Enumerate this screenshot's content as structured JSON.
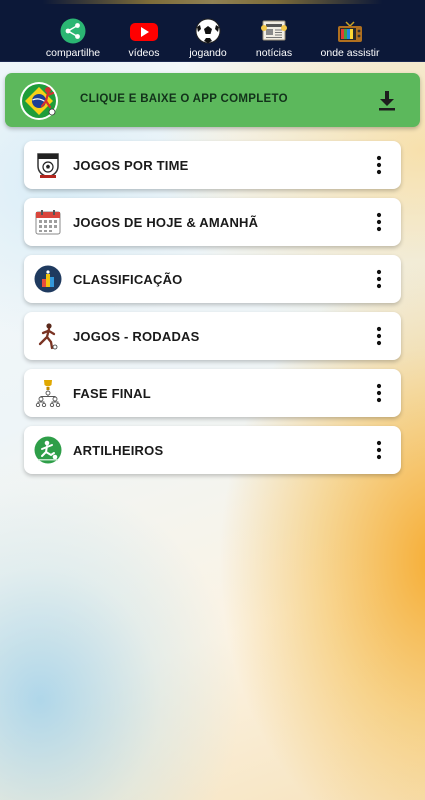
{
  "top_nav": {
    "items": [
      {
        "label": "compartilhe",
        "icon": "share-icon"
      },
      {
        "label": "vídeos",
        "icon": "youtube-icon"
      },
      {
        "label": "jogando",
        "icon": "soccer-ball-icon"
      },
      {
        "label": "notícias",
        "icon": "newspaper-icon"
      },
      {
        "label": "onde assistir",
        "icon": "tv-icon"
      }
    ]
  },
  "banner": {
    "text": "CLIQUE E BAIXE O APP COMPLETO",
    "icon": "download-icon",
    "color": "#5cb85c"
  },
  "menu": {
    "items": [
      {
        "label": "JOGOS POR TIME",
        "icon": "team-crest-icon"
      },
      {
        "label": "JOGOS DE HOJE & AMANHÃ",
        "icon": "calendar-icon"
      },
      {
        "label": "CLASSIFICAÇÃO",
        "icon": "standings-chart-icon"
      },
      {
        "label": "JOGOS - RODADAS",
        "icon": "player-icon"
      },
      {
        "label": "FASE FINAL",
        "icon": "trophy-bracket-icon"
      },
      {
        "label": "ARTILHEIROS",
        "icon": "striker-icon"
      }
    ]
  },
  "colors": {
    "topbar": "#0c1838",
    "banner": "#5cb85c",
    "card": "#ffffff"
  }
}
